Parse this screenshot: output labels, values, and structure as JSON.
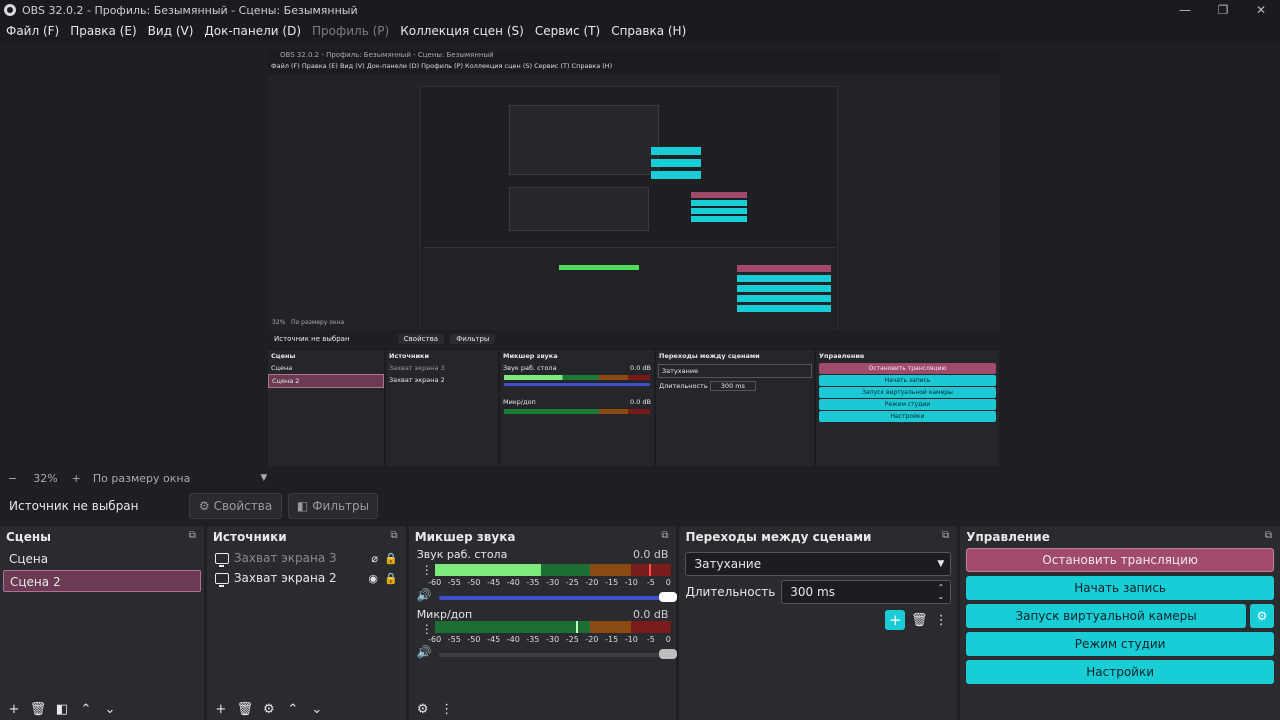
{
  "window": {
    "title": "OBS 32.0.2 - Профиль: Безымянный - Сцены: Безымянный",
    "controls": [
      "—",
      "❐",
      "✕"
    ]
  },
  "menu": [
    {
      "label": "Файл (F)",
      "disabled": false
    },
    {
      "label": "Правка (E)",
      "disabled": false
    },
    {
      "label": "Вид (V)",
      "disabled": false
    },
    {
      "label": "Док-панели (D)",
      "disabled": false
    },
    {
      "label": "Профиль (P)",
      "disabled": true
    },
    {
      "label": "Коллекция сцен (S)",
      "disabled": false
    },
    {
      "label": "Сервис (T)",
      "disabled": false
    },
    {
      "label": "Справка (H)",
      "disabled": false
    }
  ],
  "nested": {
    "title": "OBS 32.0.2 - Профиль: Безымянный - Сцены: Безымянный",
    "menu": "Файл (F)   Правка (E)   Вид (V)   Док-панели (D)   Профиль (P)   Коллекция сцен (S)   Сервис (T)   Справка (H)",
    "zoom": "32%",
    "fit": "По размеру окна",
    "source_label": "Источник не выбран",
    "properties": "Свойства",
    "filters": "Фильтры",
    "scenes_title": "Сцены",
    "scene1": "Сцена",
    "scene2": "Сцена 2",
    "sources_title": "Источники",
    "src1": "Захват экрана 3",
    "src2": "Захват экрана 2",
    "mixer_title": "Микшер звука",
    "ch1": "Звук раб. стола",
    "ch2": "Микр/доп",
    "db": "0.0 dB",
    "trans_title": "Переходы между сценами",
    "trans_value": "Затухание",
    "duration_label": "Длительность",
    "duration_value": "300 ms",
    "ctrl_title": "Управление",
    "btn_stop": "Остановить трансляцию",
    "btn_rec": "Начать запись",
    "btn_vcam": "Запуск виртуальной камеры",
    "btn_studio": "Режим студии",
    "btn_settings": "Настройки"
  },
  "zoom": {
    "minus": "−",
    "value": "32%",
    "plus": "+",
    "fit": "По размеру окна"
  },
  "source_bar": {
    "label": "Источник не выбран",
    "properties": "Свойства",
    "filters": "Фильтры"
  },
  "scenes": {
    "title": "Сцены",
    "items": [
      "Сцена",
      "Сцена 2"
    ],
    "selected": 1
  },
  "sources": {
    "title": "Источники",
    "items": [
      {
        "label": "Захват экрана 3",
        "visible": false
      },
      {
        "label": "Захват экрана 2",
        "visible": true
      }
    ]
  },
  "mixer": {
    "title": "Микшер звука",
    "channels": [
      {
        "name": "Звук раб. стола",
        "db": "0.0 dB",
        "level": 0.45
      },
      {
        "name": "Микр/доп",
        "db": "0.0 dB",
        "level": 0.6
      }
    ],
    "ticks": [
      "-60",
      "-55",
      "-50",
      "-45",
      "-40",
      "-35",
      "-30",
      "-25",
      "-20",
      "-15",
      "-10",
      "-5",
      "0"
    ]
  },
  "transitions": {
    "title": "Переходы между сценами",
    "value": "Затухание",
    "duration_label": "Длительность",
    "duration": "300 ms"
  },
  "controls": {
    "title": "Управление",
    "stop_stream": "Остановить трансляцию",
    "start_record": "Начать запись",
    "virtual_cam": "Запуск виртуальной камеры",
    "studio_mode": "Режим студии",
    "settings": "Настройки"
  },
  "colors": {
    "accent": "#18cdd6",
    "stop": "#a04a6c",
    "selected": "#6b3b53"
  }
}
